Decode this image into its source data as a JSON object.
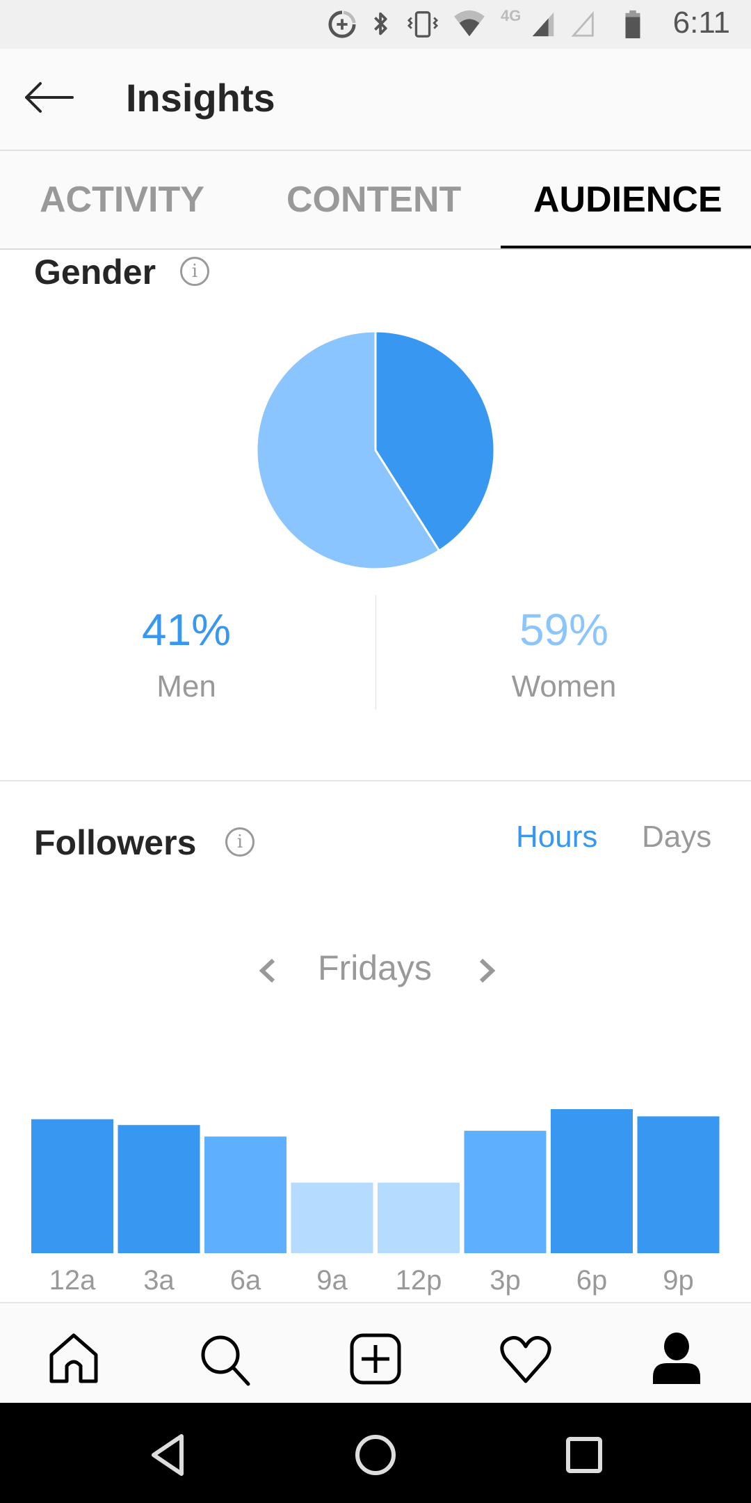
{
  "status_bar": {
    "time": "6:11",
    "network_label": "4G",
    "icons": [
      "data-saver-icon",
      "bluetooth-icon",
      "vibrate-icon",
      "wifi-icon",
      "cell-signal-icon",
      "cell-signal-empty-icon",
      "battery-icon"
    ]
  },
  "header": {
    "back_icon": "arrow-left-icon",
    "title": "Insights"
  },
  "tabs": [
    {
      "label": "ACTIVITY",
      "active": false
    },
    {
      "label": "CONTENT",
      "active": false
    },
    {
      "label": "AUDIENCE",
      "active": true
    }
  ],
  "gender": {
    "title": "Gender",
    "info_glyph": "i",
    "men": {
      "value": "41%",
      "label": "Men"
    },
    "women": {
      "value": "59%",
      "label": "Women"
    }
  },
  "followers": {
    "title": "Followers",
    "info_glyph": "i",
    "toggle": {
      "hours": "Hours",
      "days": "Days",
      "selected": "Hours"
    },
    "day_selector": {
      "label": "Fridays",
      "prev_icon": "chevron-left-icon",
      "next_icon": "chevron-right-icon"
    }
  },
  "colors": {
    "men": "#3897f0",
    "women": "#8bc5ff",
    "accent": "#3897f0",
    "bar_high": "#3897f0",
    "bar_mid": "#5eb0ff",
    "bar_low": "#b5dbff"
  },
  "chart_data": [
    {
      "type": "pie",
      "title": "Gender",
      "categories": [
        "Men",
        "Women"
      ],
      "values": [
        41,
        59
      ],
      "colors": [
        "#3897f0",
        "#8bc5ff"
      ],
      "start": "top, clockwise"
    },
    {
      "type": "bar",
      "title": "Followers",
      "subtitle": "Fridays",
      "categories": [
        "12a",
        "3a",
        "6a",
        "9a",
        "12p",
        "3p",
        "6p",
        "9p"
      ],
      "values": [
        0.93,
        0.89,
        0.81,
        0.49,
        0.49,
        0.85,
        1.0,
        0.95
      ],
      "value_units": "relative to max (no axis shown)",
      "intensity": [
        "high",
        "high",
        "mid",
        "low",
        "low",
        "mid",
        "high",
        "high"
      ],
      "xlabel": "",
      "ylabel": "",
      "ylim": [
        0,
        1.0
      ],
      "grid": false,
      "legend": "none"
    }
  ],
  "bottom_nav": {
    "items": [
      "home-icon",
      "search-icon",
      "add-post-icon",
      "activity-heart-icon",
      "profile-icon"
    ],
    "active": "profile-icon"
  },
  "system_nav": {
    "items": [
      "system-back-icon",
      "system-home-icon",
      "system-recents-icon"
    ]
  }
}
